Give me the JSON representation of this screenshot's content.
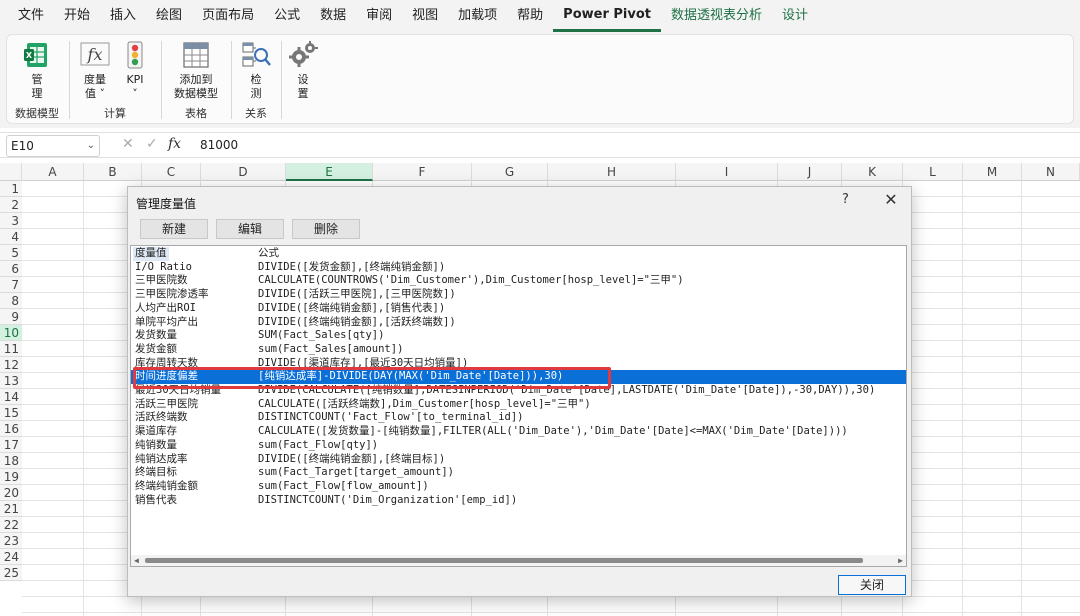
{
  "ribbon_tabs": [
    {
      "label": "文件"
    },
    {
      "label": "开始"
    },
    {
      "label": "插入"
    },
    {
      "label": "绘图"
    },
    {
      "label": "页面布局"
    },
    {
      "label": "公式"
    },
    {
      "label": "数据"
    },
    {
      "label": "审阅"
    },
    {
      "label": "视图"
    },
    {
      "label": "加载项"
    },
    {
      "label": "帮助"
    },
    {
      "label": "Power Pivot"
    },
    {
      "label": "数据透视表分析"
    },
    {
      "label": "设计"
    }
  ],
  "ribbon": {
    "groups": {
      "data_model": "数据模型",
      "calculation": "计算",
      "tables": "表格",
      "relationships": "关系"
    },
    "buttons": {
      "manage": "管\n理",
      "measure": "度量\n值 ˅",
      "kpi": "KPI\n˅",
      "add_to_model": "添加到\n数据模型",
      "detect": "检\n测",
      "settings": "设\n置"
    }
  },
  "formula_bar": {
    "name_box": "E10",
    "fx": "fx",
    "value": "81000"
  },
  "grid": {
    "columns": [
      "A",
      "B",
      "C",
      "D",
      "E",
      "F",
      "G",
      "H",
      "I",
      "J",
      "K",
      "L",
      "M",
      "N"
    ],
    "rows": [
      "1",
      "2",
      "3",
      "4",
      "5",
      "6",
      "7",
      "8",
      "9",
      "10",
      "11",
      "12",
      "13",
      "14",
      "15",
      "16",
      "17",
      "18",
      "19",
      "20",
      "21",
      "22",
      "23",
      "24",
      "25"
    ]
  },
  "dialog": {
    "title": "管理度量值",
    "help": "?",
    "close_x": "✕",
    "buttons": {
      "new": "新建",
      "edit": "编辑",
      "delete": "删除",
      "close": "关闭"
    },
    "headers": {
      "name": "度量值",
      "formula": "公式"
    },
    "measures": [
      {
        "name": "I/O Ratio",
        "formula": "DIVIDE([发货金额],[终端纯销金额])"
      },
      {
        "name": "三甲医院数",
        "formula": "CALCULATE(COUNTROWS('Dim_Customer'),Dim_Customer[hosp_level]=\"三甲\")"
      },
      {
        "name": "三甲医院渗透率",
        "formula": "DIVIDE([活跃三甲医院],[三甲医院数])"
      },
      {
        "name": "人均产出ROI",
        "formula": "DIVIDE([终端纯销金额],[销售代表])"
      },
      {
        "name": "单院平均产出",
        "formula": "DIVIDE([终端纯销金额],[活跃终端数])"
      },
      {
        "name": "发货数量",
        "formula": "SUM(Fact_Sales[qty])"
      },
      {
        "name": "发货金额",
        "formula": "sum(Fact_Sales[amount])"
      },
      {
        "name": "库存周转天数",
        "formula": "DIVIDE([渠道库存],[最近30天日均销量])"
      },
      {
        "name": "时间进度偏差",
        "formula": "[纯销达成率]-DIVIDE(DAY(MAX('Dim_Date'[Date])),30)"
      },
      {
        "name": "最近30天日均销量",
        "formula": "DIVIDE(CALCULATE([纯销数量],DATESINPERIOD('Dim_Date'[Date],LASTDATE('Dim_Date'[Date]),-30,DAY)),30)"
      },
      {
        "name": "活跃三甲医院",
        "formula": "CALCULATE([活跃终端数],Dim_Customer[hosp_level]=\"三甲\")"
      },
      {
        "name": "活跃终端数",
        "formula": "DISTINCTCOUNT('Fact_Flow'[to_terminal_id])"
      },
      {
        "name": "渠道库存",
        "formula": "CALCULATE([发货数量]-[纯销数量],FILTER(ALL('Dim_Date'),'Dim_Date'[Date]<=MAX('Dim_Date'[Date])))"
      },
      {
        "name": "纯销数量",
        "formula": "sum(Fact_Flow[qty])"
      },
      {
        "name": "纯销达成率",
        "formula": "DIVIDE([终端纯销金额],[终端目标])"
      },
      {
        "name": "终端目标",
        "formula": "sum(Fact_Target[target_amount])"
      },
      {
        "name": "终端纯销金额",
        "formula": "sum(Fact_Flow[flow_amount])"
      },
      {
        "name": "销售代表",
        "formula": "DISTINCTCOUNT('Dim_Organization'[emp_id])"
      }
    ]
  },
  "icons": {
    "manage": "excel-table-icon",
    "measure": "fx-icon",
    "kpi": "kpi-icon",
    "add_to_model": "table-grid-icon",
    "detect": "detect-icon",
    "settings": "gear-icon"
  },
  "colors": {
    "accent_green": "#1e7145",
    "selection_blue": "#0a6fd6",
    "highlight_red": "#e0393e"
  }
}
